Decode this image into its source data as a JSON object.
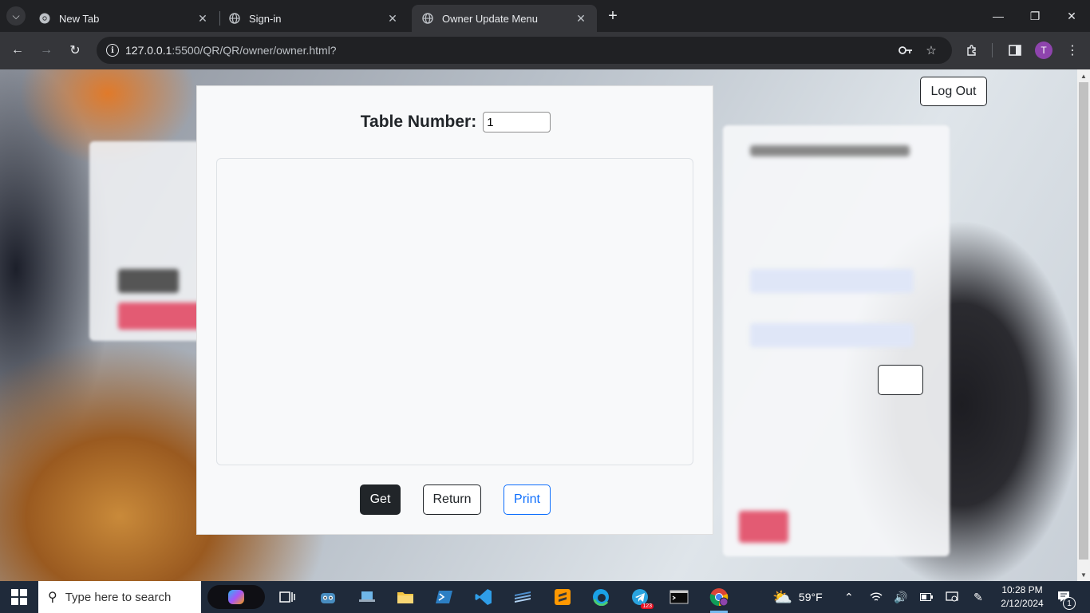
{
  "browser": {
    "tabs": [
      {
        "label": "New Tab",
        "active": false
      },
      {
        "label": "Sign-in",
        "active": false
      },
      {
        "label": "Owner Update Menu",
        "active": true
      }
    ],
    "url_host": "127.0.0.1",
    "url_path": ":5500/QR/QR/owner/owner.html?",
    "profile_initial": "T"
  },
  "page": {
    "table_number_label": "Table Number:",
    "table_number_value": "1",
    "buttons": {
      "get": "Get",
      "return": "Return",
      "print": "Print"
    },
    "logout_label": "Log Out"
  },
  "taskbar": {
    "search_placeholder": "Type here to search",
    "weather_temp": "59°F",
    "time": "10:28 PM",
    "date": "2/12/2024",
    "telegram_badge": "123",
    "notification_count": "1"
  },
  "colors": {
    "primary_dark": "#212529",
    "print_blue": "#0d6efd",
    "card_bg": "#f8f9fa"
  }
}
